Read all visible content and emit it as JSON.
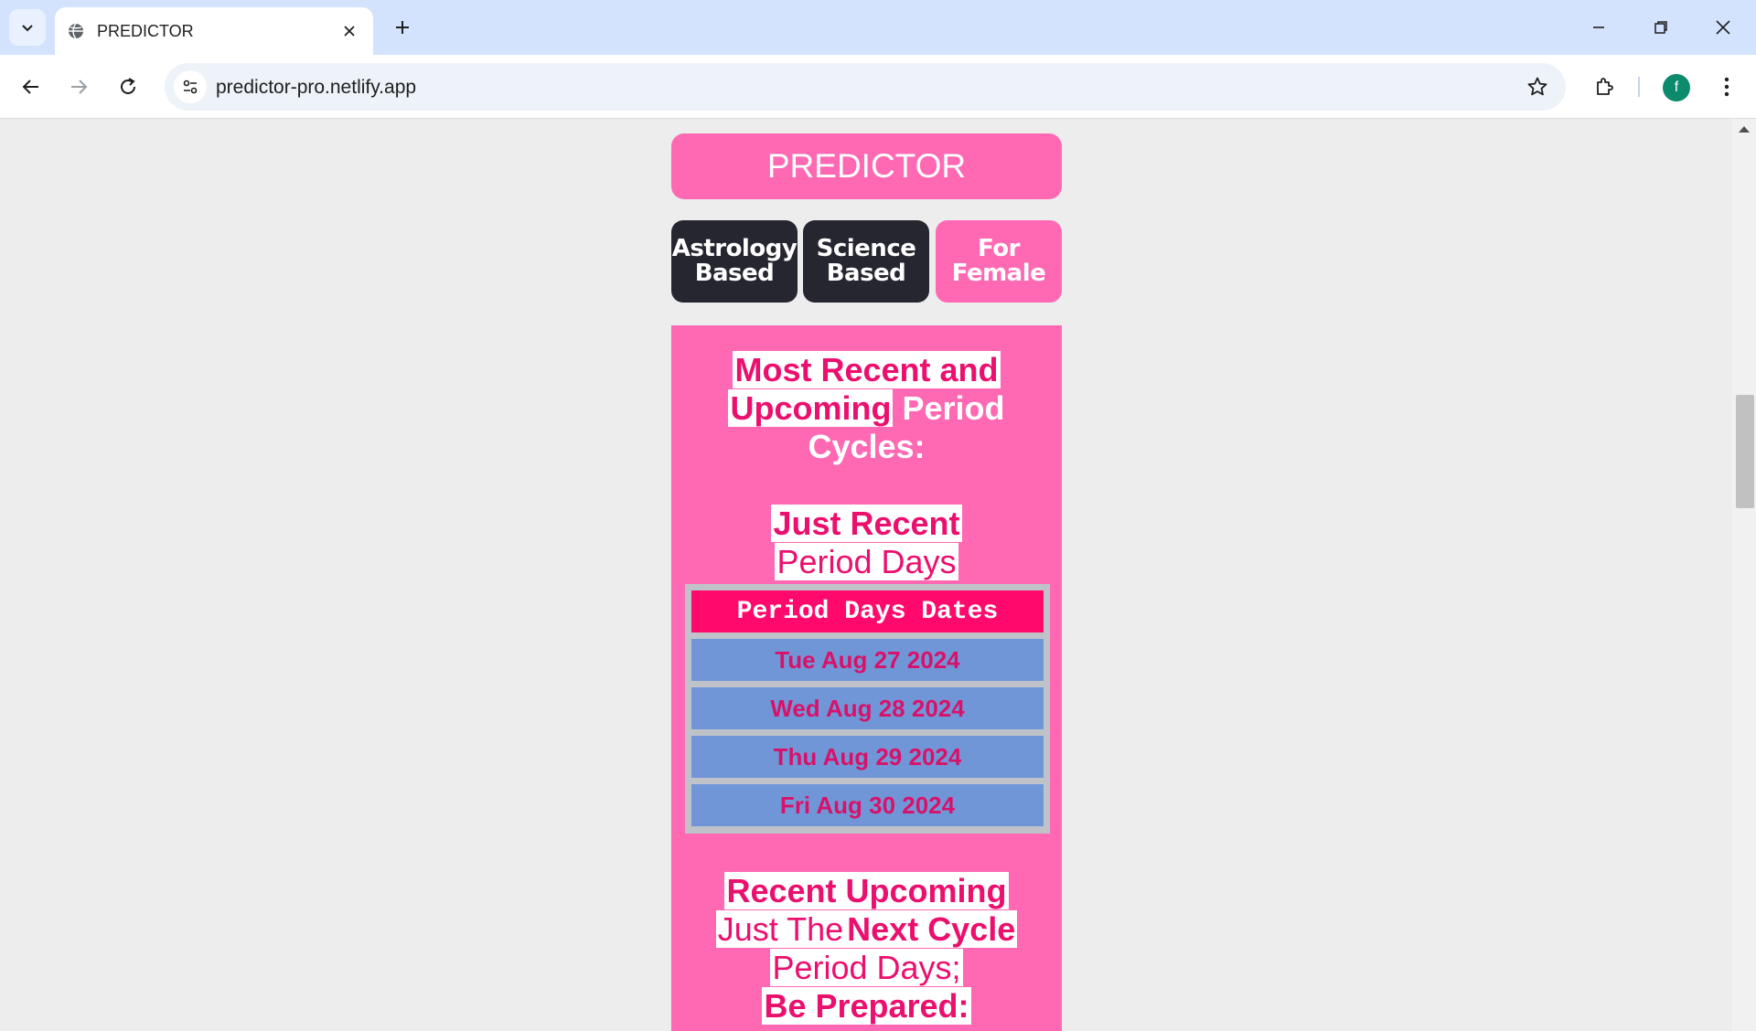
{
  "browser": {
    "tab_title": "PREDICTOR",
    "url": "predictor-pro.netlify.app",
    "profile_initial": "f"
  },
  "app": {
    "title": "PREDICTOR",
    "modes": [
      {
        "line1": "Astrology",
        "line2": "Based"
      },
      {
        "line1": "Science",
        "line2": "Based"
      },
      {
        "line1": "For",
        "line2": "Female"
      }
    ]
  },
  "section": {
    "heading_hl_1": "Most Recent and",
    "heading_hl_2": "Upcoming",
    "heading_rest_2": "Period",
    "heading_rest_3": "Cycles:",
    "recent_bold": "Just Recent",
    "recent_plain": "Period Days",
    "table_header": "Period Days Dates",
    "dates": [
      "Tue Aug 27 2024",
      "Wed Aug 28 2024",
      "Thu Aug 29 2024",
      "Fri Aug 30 2024"
    ],
    "upcoming_bold": "Recent Upcoming",
    "upcoming_plain_a": "Just The",
    "upcoming_bold_b": "Next Cycle",
    "upcoming_plain_c": "Period Days;",
    "prepared": "Be Prepared:"
  },
  "colors": {
    "pink": "#ff69b4",
    "dark": "#25262f",
    "accent": "#eb0f6e",
    "table_header": "#ff0a6c",
    "row_bg": "#7196d7"
  }
}
